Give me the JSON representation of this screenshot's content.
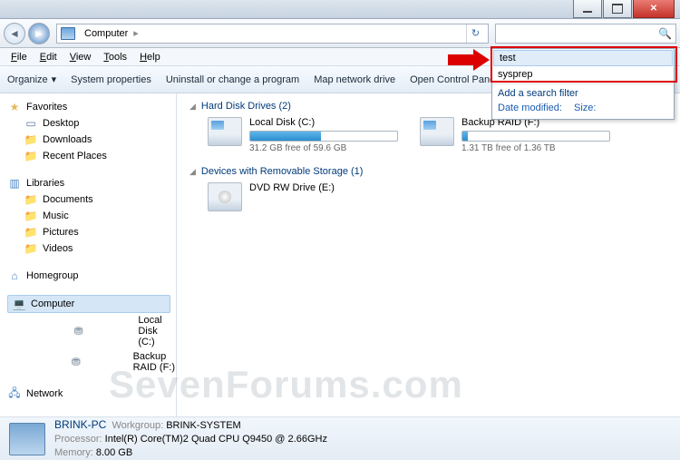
{
  "titlebar": {
    "min": "minimize",
    "max": "maximize",
    "close": "close"
  },
  "nav": {
    "back": "◄",
    "fwd": "►",
    "location_icon": "computer",
    "crumb": "Computer",
    "refresh": "↻",
    "search_placeholder": "",
    "search_icon": "🔍"
  },
  "menu": {
    "file": "File",
    "edit": "Edit",
    "view": "View",
    "tools": "Tools",
    "help": "Help"
  },
  "toolbar": {
    "organize": "Organize",
    "sysprops": "System properties",
    "uninstall": "Uninstall or change a program",
    "mapdrive": "Map network drive",
    "opencp": "Open Control Panel"
  },
  "sidebar": {
    "favorites": {
      "label": "Favorites",
      "items": [
        "Desktop",
        "Downloads",
        "Recent Places"
      ]
    },
    "libraries": {
      "label": "Libraries",
      "items": [
        "Documents",
        "Music",
        "Pictures",
        "Videos"
      ]
    },
    "homegroup": {
      "label": "Homegroup"
    },
    "computer": {
      "label": "Computer",
      "items": [
        "Local Disk (C:)",
        "Backup RAID (F:)"
      ]
    },
    "network": {
      "label": "Network"
    }
  },
  "content": {
    "hdd_header": "Hard Disk Drives (2)",
    "removable_header": "Devices with Removable Storage (1)",
    "drives": [
      {
        "name": "Local Disk (C:)",
        "free": "31.2 GB free of 59.6 GB",
        "pct": 48
      },
      {
        "name": "Backup RAID (F:)",
        "free": "1.31 TB free of 1.36 TB",
        "pct": 4
      }
    ],
    "removable": [
      {
        "name": "DVD RW Drive (E:)"
      }
    ]
  },
  "details": {
    "name": "BRINK-PC",
    "workgroup_label": "Workgroup:",
    "workgroup": "BRINK-SYSTEM",
    "proc_label": "Processor:",
    "proc": "Intel(R) Core(TM)2 Quad  CPU   Q9450  @ 2.66GHz",
    "mem_label": "Memory:",
    "mem": "8.00 GB"
  },
  "searchdrop": {
    "suggestions": [
      "test",
      "sysprep"
    ],
    "filter_label": "Add a search filter",
    "filters": [
      "Date modified:",
      "Size:"
    ]
  },
  "watermark": "SevenForums.com"
}
